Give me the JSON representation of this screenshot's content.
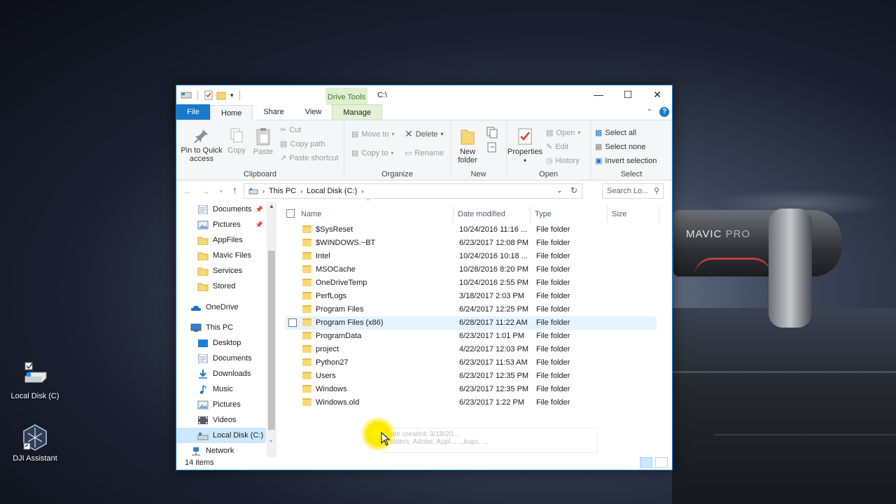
{
  "desktop": {
    "icons": [
      {
        "label": "Local Disk (C)",
        "icon": "drive-icon"
      },
      {
        "label": "DJI Assistant",
        "icon": "dji-app-icon"
      }
    ],
    "wallpaper_brand": "MAVIC",
    "wallpaper_brand_suffix": "PRO"
  },
  "window": {
    "title": "C:\\",
    "context_tab": "Drive Tools",
    "tabs": [
      "File",
      "Home",
      "Share",
      "View",
      "Manage"
    ],
    "active_tab": "Home",
    "controls": [
      "minimize",
      "maximize",
      "close"
    ]
  },
  "ribbon": {
    "clipboard": {
      "label": "Clipboard",
      "pin": "Pin to Quick access",
      "pin_line1": "Pin to Quick",
      "pin_line2": "access",
      "copy": "Copy",
      "paste": "Paste",
      "cut": "Cut",
      "copy_path": "Copy path",
      "paste_shortcut": "Paste shortcut"
    },
    "organize": {
      "label": "Organize",
      "move_to": "Move to",
      "copy_to": "Copy to",
      "delete": "Delete",
      "rename": "Rename"
    },
    "new": {
      "label": "New",
      "new_folder_line1": "New",
      "new_folder_line2": "folder"
    },
    "open": {
      "label": "Open",
      "properties": "Properties",
      "open": "Open",
      "edit": "Edit",
      "history": "History"
    },
    "select": {
      "label": "Select",
      "select_all": "Select all",
      "select_none": "Select none",
      "invert": "Invert selection"
    }
  },
  "address": {
    "crumbs": [
      "This PC",
      "Local Disk (C:)"
    ],
    "search_placeholder": "Search Lo..."
  },
  "nav": {
    "items": [
      {
        "label": "Documents",
        "icon": "documents-icon",
        "pinned": true
      },
      {
        "label": "Pictures",
        "icon": "pictures-icon",
        "pinned": true
      },
      {
        "label": "AppFiles",
        "icon": "folder-icon"
      },
      {
        "label": "Mavic Files",
        "icon": "folder-icon"
      },
      {
        "label": "Services",
        "icon": "folder-icon"
      },
      {
        "label": "Stored",
        "icon": "folder-icon"
      },
      {
        "label": "OneDrive",
        "icon": "onedrive-icon"
      },
      {
        "label": "This PC",
        "icon": "this-pc-icon"
      },
      {
        "label": "Desktop",
        "icon": "desktop-icon"
      },
      {
        "label": "Documents",
        "icon": "documents-icon"
      },
      {
        "label": "Downloads",
        "icon": "downloads-icon"
      },
      {
        "label": "Music",
        "icon": "music-icon"
      },
      {
        "label": "Pictures",
        "icon": "pictures-icon"
      },
      {
        "label": "Videos",
        "icon": "videos-icon"
      },
      {
        "label": "Local Disk (C:)",
        "icon": "drive-icon",
        "selected": true
      },
      {
        "label": "Network",
        "icon": "network-icon"
      }
    ]
  },
  "columns": {
    "name": "Name",
    "date": "Date modified",
    "type": "Type",
    "size": "Size"
  },
  "files": [
    {
      "name": "$SysReset",
      "date": "10/24/2016 11:16 ...",
      "type": "File folder"
    },
    {
      "name": "$WINDOWS.~BT",
      "date": "6/23/2017 12:08 PM",
      "type": "File folder"
    },
    {
      "name": "Intel",
      "date": "10/24/2016 10:18 ...",
      "type": "File folder"
    },
    {
      "name": "MSOCache",
      "date": "10/28/2016 8:20 PM",
      "type": "File folder"
    },
    {
      "name": "OneDriveTemp",
      "date": "10/24/2016 2:55 PM",
      "type": "File folder"
    },
    {
      "name": "PerfLogs",
      "date": "3/18/2017 2:03 PM",
      "type": "File folder"
    },
    {
      "name": "Program Files",
      "date": "6/24/2017 12:25 PM",
      "type": "File folder"
    },
    {
      "name": "Program Files (x86)",
      "date": "6/28/2017 11:22 AM",
      "type": "File folder",
      "hover": true
    },
    {
      "name": "ProgramData",
      "date": "6/23/2017 1:01 PM",
      "type": "File folder"
    },
    {
      "name": "project",
      "date": "4/22/2017 12:03 PM",
      "type": "File folder"
    },
    {
      "name": "Python27",
      "date": "6/23/2017 11:53 AM",
      "type": "File folder"
    },
    {
      "name": "Users",
      "date": "6/23/2017 12:35 PM",
      "type": "File folder"
    },
    {
      "name": "Windows",
      "date": "6/23/2017 12:35 PM",
      "type": "File folder"
    },
    {
      "name": "Windows.old",
      "date": "6/23/2017 1:22 PM",
      "type": "File folder"
    }
  ],
  "tooltip": {
    "line1": "Date created: 3/18/20...",
    "line2": "Folders: Adobe, Appl... ...kups, ..."
  },
  "status": {
    "count": "14 items"
  },
  "colors": {
    "accent": "#1979ca",
    "hover_row": "#e5f3ff",
    "selected_nav": "#cce8ff",
    "folder": "#f8d775",
    "drive_tools_bg": "#dff0d0"
  }
}
